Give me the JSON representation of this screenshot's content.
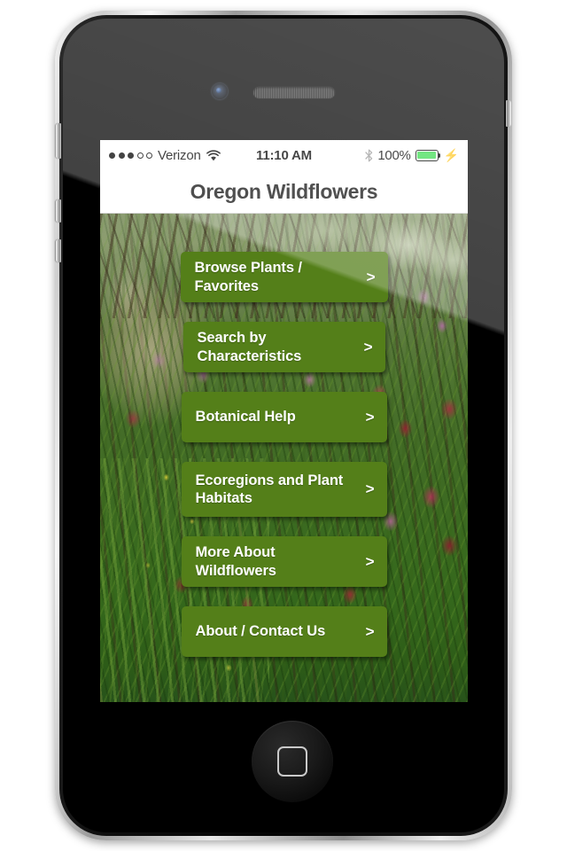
{
  "device": {
    "name": "iphone-4",
    "camera": "front-camera",
    "speaker": "earpiece-speaker",
    "home_button": "home-button"
  },
  "status_bar": {
    "signal_dots_filled": 3,
    "signal_dots_total": 5,
    "carrier": "Verizon",
    "wifi": "wifi-icon",
    "time": "11:10 AM",
    "bluetooth": "bluetooth-icon",
    "battery_percent": "100%",
    "battery_level": 100,
    "charging": true,
    "battery_color": "#3ddc52"
  },
  "nav": {
    "title": "Oregon Wildflowers"
  },
  "theme": {
    "button_green": "#547f19",
    "button_text": "#ffffff",
    "nav_background": "#ffffff"
  },
  "menu": {
    "chevron": ">",
    "items": [
      {
        "label": "Browse Plants / Favorites"
      },
      {
        "label": "Search by Characteristics"
      },
      {
        "label": "Botanical Help"
      },
      {
        "label": "Ecoregions and Plant Habitats"
      },
      {
        "label": "More About Wildflowers"
      },
      {
        "label": "About / Contact Us"
      }
    ]
  }
}
